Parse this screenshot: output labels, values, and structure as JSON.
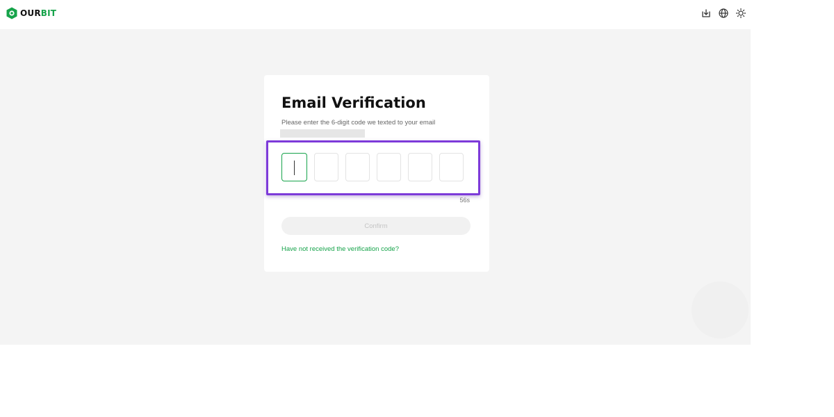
{
  "header": {
    "brand": {
      "prefix": "OUR",
      "accent": "BIT"
    },
    "icons": [
      "download-icon",
      "globe-icon",
      "sun-icon"
    ]
  },
  "verification": {
    "title": "Email Verification",
    "subtitle": "Please enter the 6-digit code we texted to your email",
    "countdown": "56s",
    "confirm_label": "Confirm",
    "resend_link": "Have not received the verification code?"
  },
  "colors": {
    "brand": "#16a34a",
    "highlight": "#7d3ad9",
    "background": "#f4f4f4"
  }
}
